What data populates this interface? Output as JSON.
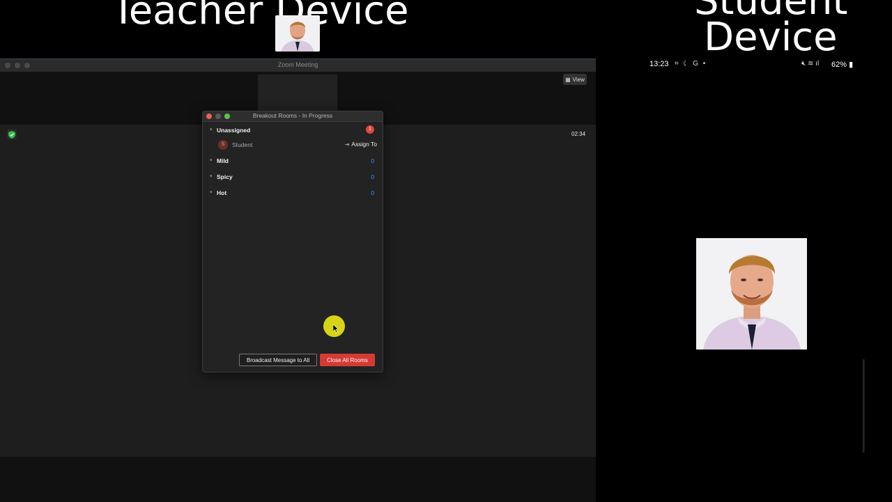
{
  "overlay_titles": {
    "teacher": "Teacher Device",
    "student_line1": "Student",
    "student_line2": "Device"
  },
  "zoom_window": {
    "title": "Zoom Meeting",
    "view_button_label": "View",
    "meeting_timer": "02:34"
  },
  "breakout_dialog": {
    "title": "Breakout Rooms - In Progress",
    "unassigned": {
      "label": "Unassigned",
      "badge_count": "1",
      "participant": {
        "initial": "S",
        "name": "Student",
        "assign_label": "Assign To"
      }
    },
    "rooms": [
      {
        "name": "Mild",
        "count": "0"
      },
      {
        "name": "Spicy",
        "count": "0"
      },
      {
        "name": "Hot",
        "count": "0"
      }
    ],
    "broadcast_button": "Broadcast Message to All",
    "close_button": "Close All Rooms"
  },
  "phone_status": {
    "time": "13:23",
    "battery": "62%"
  },
  "colors": {
    "accent_blue": "#3f8cff",
    "danger_red": "#d63a34",
    "cursor_highlight": "#e0de14"
  },
  "icons": [
    "shield-icon",
    "grid-icon",
    "signal-icon",
    "assign-icon",
    "chevron-down-icon"
  ]
}
